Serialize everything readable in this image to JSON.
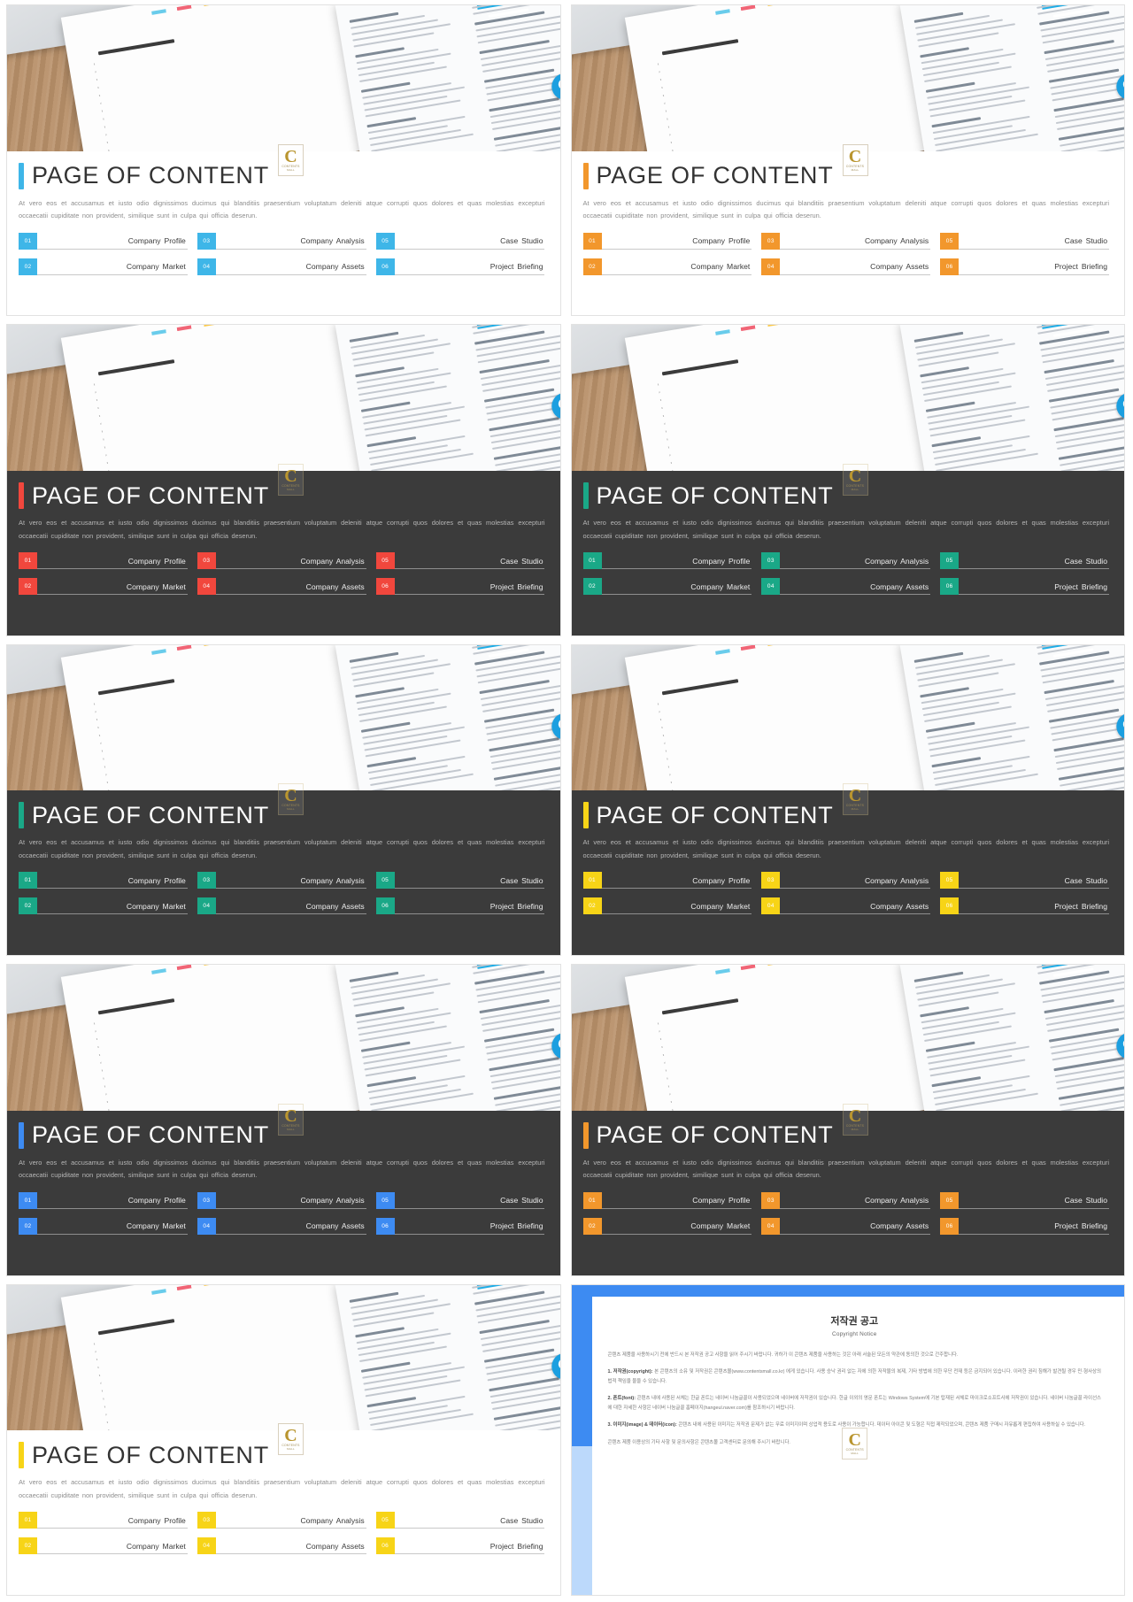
{
  "slides": [
    {
      "accent": "#3eb6e8",
      "theme": "light",
      "title": "PAGE OF CONTENT"
    },
    {
      "accent": "#f2972c",
      "theme": "light",
      "title": "PAGE OF CONTENT"
    },
    {
      "accent": "#f1473d",
      "theme": "dark",
      "title": "PAGE OF CONTENT"
    },
    {
      "accent": "#1aa887",
      "theme": "dark",
      "title": "PAGE OF CONTENT"
    },
    {
      "accent": "#1aa887",
      "theme": "dark",
      "title": "PAGE OF CONTENT"
    },
    {
      "accent": "#f7d417",
      "theme": "dark",
      "title": "PAGE OF CONTENT"
    },
    {
      "accent": "#3d8bf2",
      "theme": "dark",
      "title": "PAGE OF CONTENT"
    },
    {
      "accent": "#f2972c",
      "theme": "dark",
      "title": "PAGE OF CONTENT"
    },
    {
      "accent": "#f7d417",
      "theme": "light",
      "title": "PAGE OF CONTENT"
    }
  ],
  "common": {
    "paragraph": "At vero eos et accusamus et iusto odio dignissimos ducimus qui blanditiis praesentium voluptatum deleniti atque corrupti quos dolores et quas molestias excepturi occaecatii cupiditate non provident, similique sunt in culpa qui officia deserun.",
    "items": [
      {
        "num": "01",
        "label": "Company Profile"
      },
      {
        "num": "03",
        "label": "Company Analysis"
      },
      {
        "num": "05",
        "label": "Case Studio"
      },
      {
        "num": "02",
        "label": "Company Market"
      },
      {
        "num": "04",
        "label": "Company Assets"
      },
      {
        "num": "06",
        "label": "Project Briefing"
      }
    ],
    "watermark": {
      "letter": "C",
      "line1": "CONTENTS",
      "line2": "MALL"
    }
  },
  "copyright": {
    "accent": "#3d8bf2",
    "heading_ko": "저작권 공고",
    "heading_en": "Copyright Notice",
    "intro": "콘텐츠 제품을 사용하시기 전에 반드시 본 저작권 공고 사항을 읽어 주시기 바랍니다. 귀하가 이 콘텐츠 제품을 사용하는 것은 아래 서술된 모든의 약관에 동의한 것으로 간주합니다.",
    "sections": [
      {
        "title": "1. 저작권(copyright):",
        "text": "본 콘텐츠의 소유 및 저작권은 콘텐츠몰(www.contentsmall.co.kr) 에게 있습니다. 사용 승낙 권리 없는 자에 의한 저작물의 복제, 기타 방법에 의한 무단 전재 등은 금지되어 있습니다. 이러한 권리 침해가 발견될 경우 민·형사상의 법적 책임을 물을 수 있습니다."
      },
      {
        "title": "2. 폰트(font):",
        "text": "콘텐츠 내에 사용된 서체는 한글 폰트는 네이버 나눔글꼴이 사용되었으며 네이버에 저작권이 있습니다. 한글 이외의 영문 폰트는 Windows System에 기본 탑재된 서체로 마이크로소프트사에 저작권이 있습니다. 네이버 나눔글꼴 라이선스에 대한 자세한 사항은 네이버 나눔글꼴 홈페이지(hangeul.naver.com)를 참조하시기 바랍니다."
      },
      {
        "title": "3. 이미지(image) & 데이터(icon):",
        "text": "콘텐츠 내에 사용된 이미지는 저작권 문제가 없는 무료 이미지이며 상업적 용도로 사용이 가능합니다. 데이터 아이콘 및 도형은 직접 제작되었으며, 콘텐츠 제품 구매시 자유롭게 편집하여 사용하실 수 있습니다."
      }
    ],
    "outro": "콘텐츠 제품 이용상의 기타 사항 및 문의사항은 콘텐츠몰 고객센터로 문의해 주시기 바랍니다."
  }
}
